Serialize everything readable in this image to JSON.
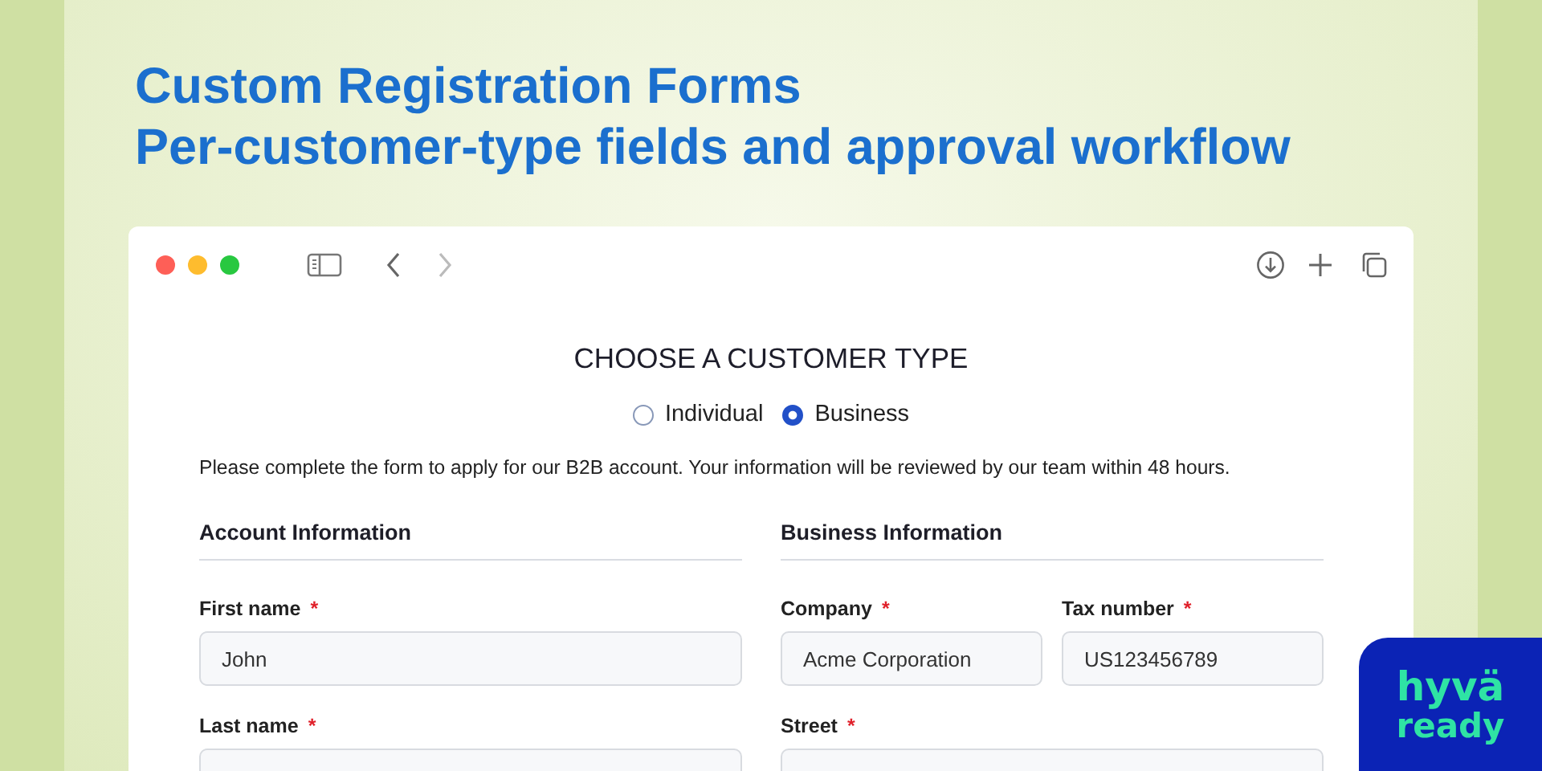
{
  "headline": [
    "Custom Registration Forms",
    "Per-customer-type fields and approval workflow"
  ],
  "form": {
    "title": "CHOOSE A CUSTOMER TYPE",
    "customer_types": [
      {
        "label": "Individual",
        "selected": false
      },
      {
        "label": "Business",
        "selected": true
      }
    ],
    "note": "Please complete the form to apply for our B2B account. Your information will be reviewed by our team within 48 hours.",
    "required_mark": "*",
    "sections": [
      {
        "title": "Account Information",
        "rows": [
          [
            {
              "label": "First name",
              "required": true,
              "value": "John"
            }
          ],
          [
            {
              "label": "Last name",
              "required": true
            }
          ]
        ]
      },
      {
        "title": "Business Information",
        "rows": [
          [
            {
              "label": "Company",
              "required": true,
              "value": "Acme Corporation"
            },
            {
              "label": "Tax number",
              "required": true,
              "value": "US123456789"
            }
          ],
          [
            {
              "label": "Street",
              "required": true
            }
          ]
        ]
      }
    ]
  },
  "badge": [
    "hyvä",
    "ready"
  ]
}
